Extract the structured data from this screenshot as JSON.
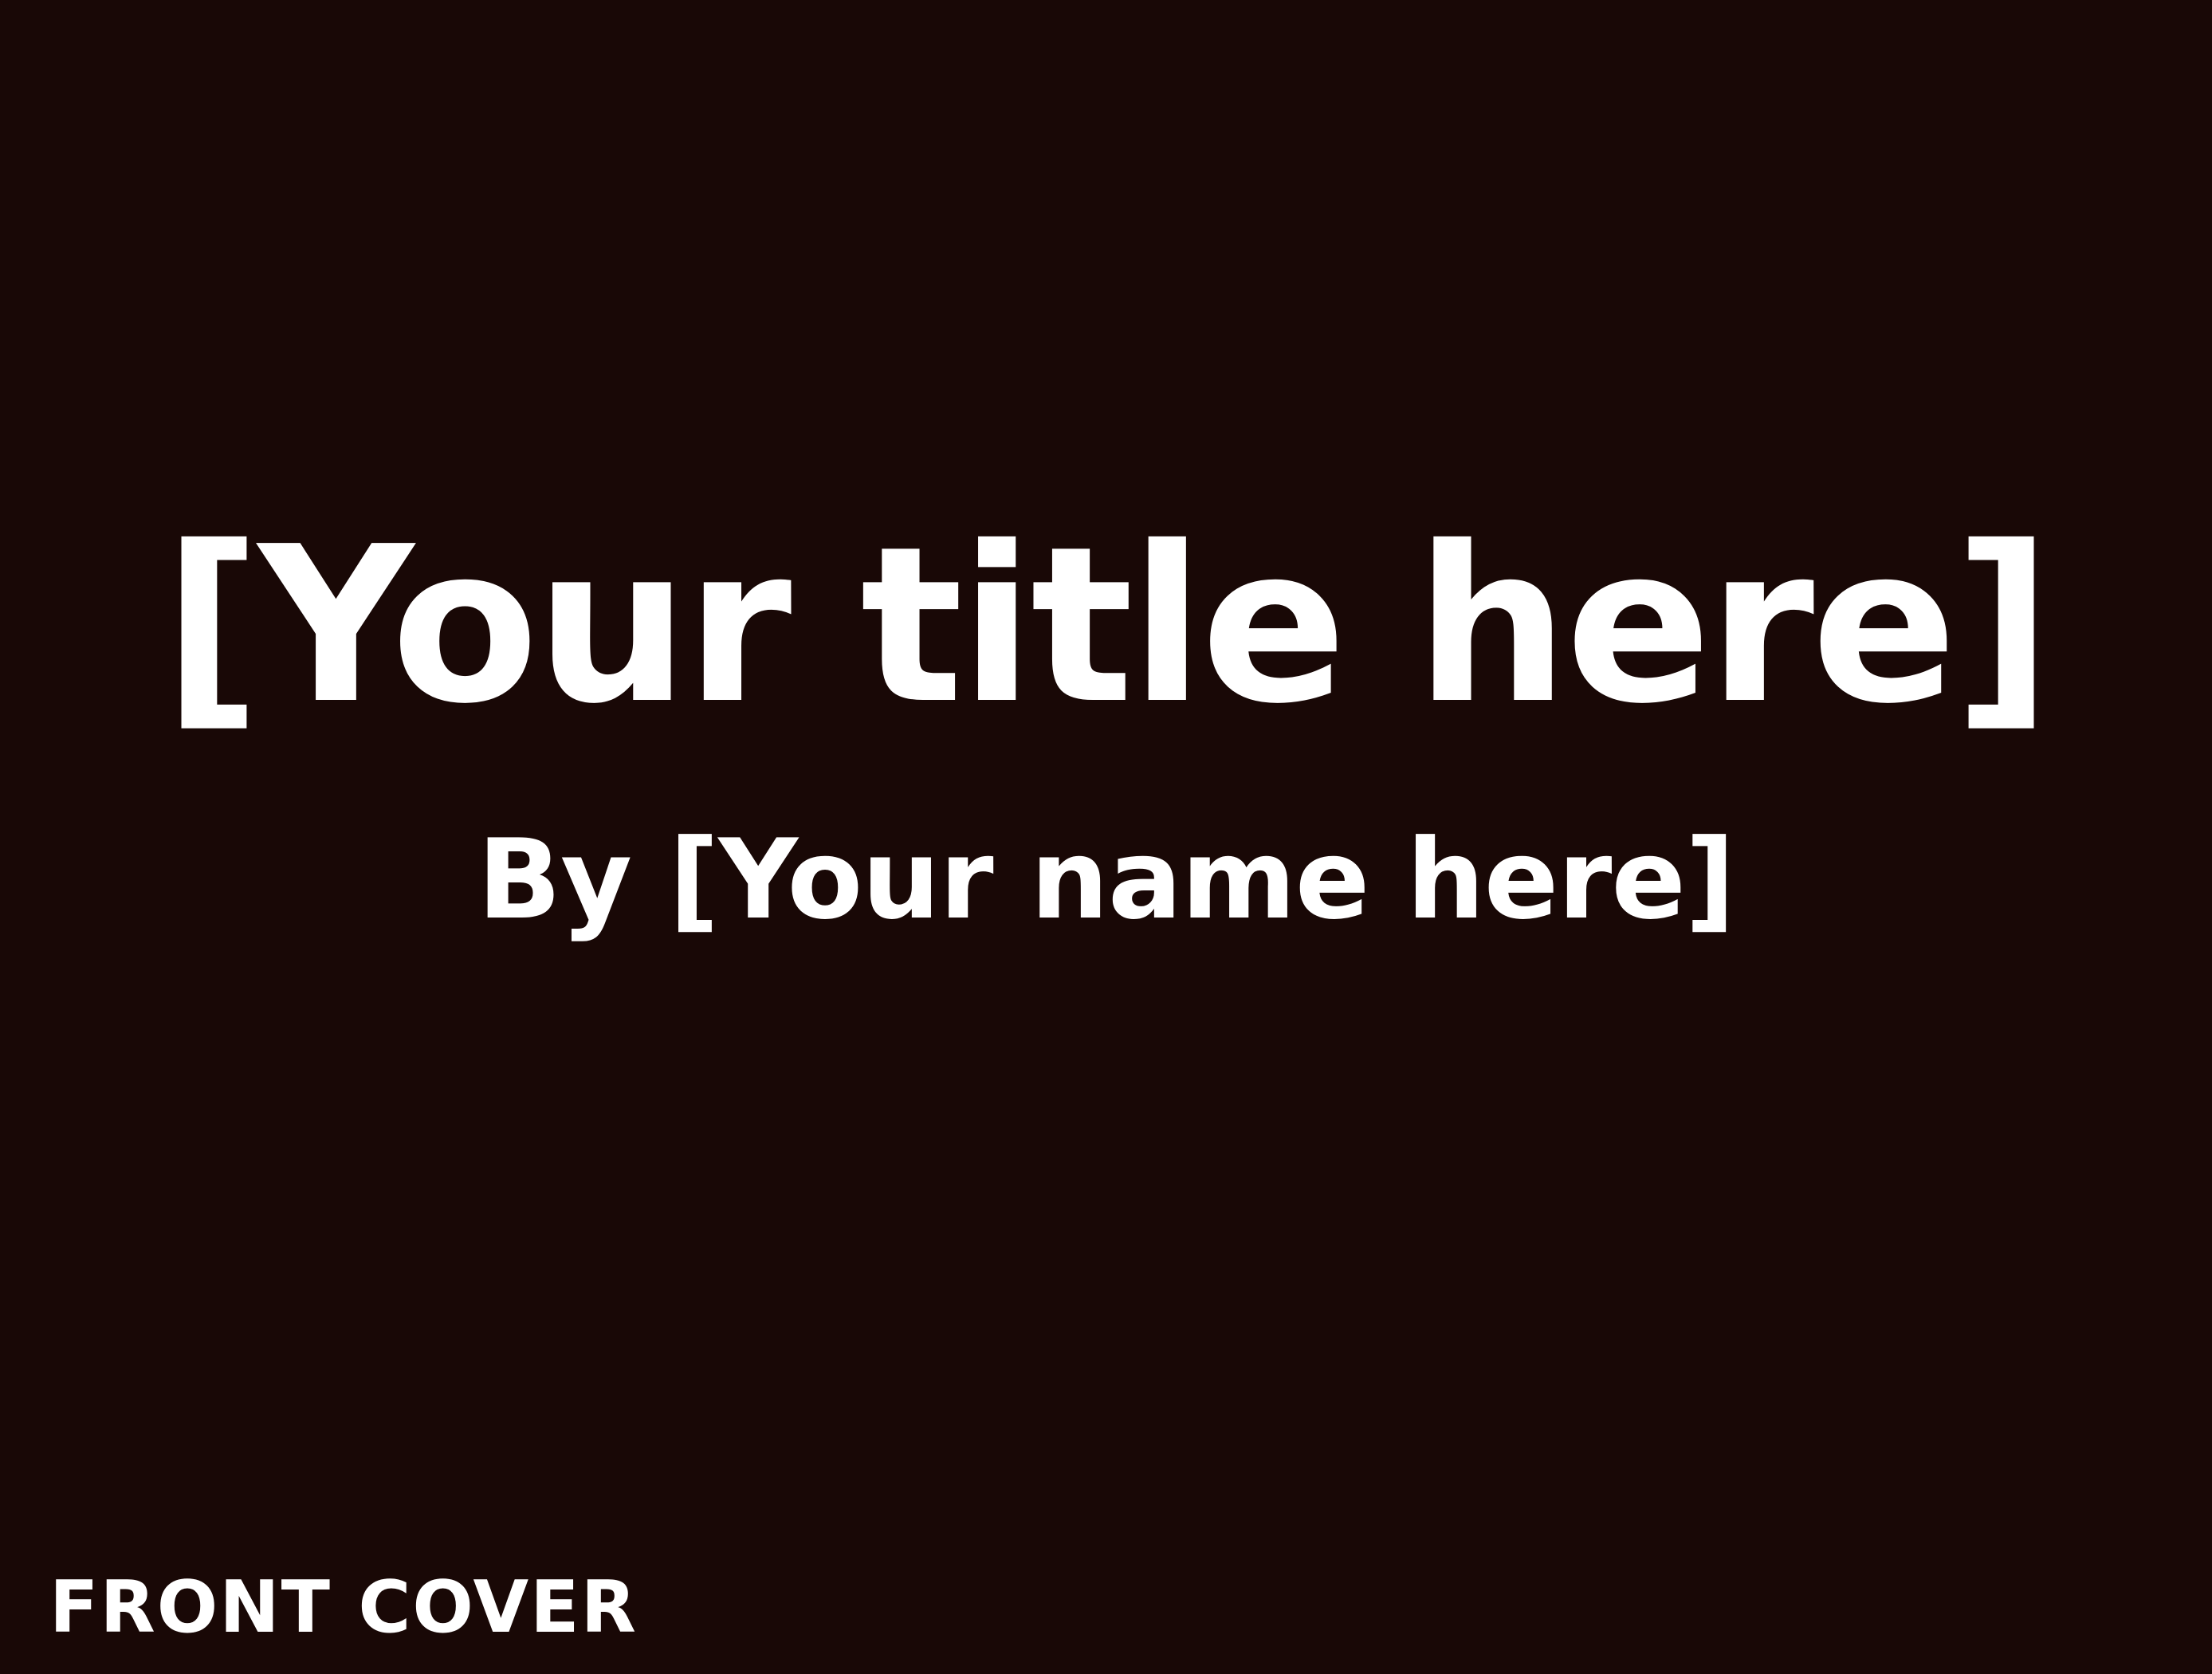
{
  "cover": {
    "title": "[Your title here]",
    "byline": "By [Your name here]",
    "section_label": "FRONT COVER",
    "background_color": "#190806",
    "text_color": "#ffffff"
  }
}
